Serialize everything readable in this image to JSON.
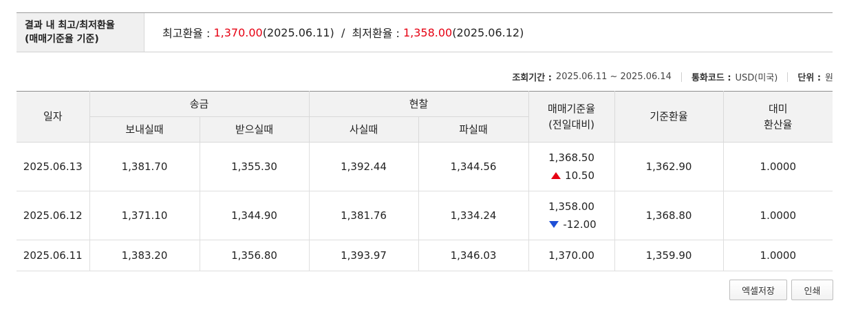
{
  "summary": {
    "label_line1": "결과 내 최고/최저환율",
    "label_line2": "(매매기준율 기준)",
    "high_label": "최고환율 : ",
    "high_value": "1,370.00",
    "high_date": "(2025.06.11)",
    "divider": "  /  ",
    "low_label": "최저환율 : ",
    "low_value": "1,358.00",
    "low_date": "(2025.06.12)",
    "highlight_color": "#e60012"
  },
  "meta": {
    "period_label": "조회기간 :",
    "period_value": "2025.06.11 ~ 2025.06.14",
    "currency_label": "통화코드 :",
    "currency_value": "USD(미국)",
    "unit_label": "단위 :",
    "unit_value": "원"
  },
  "table": {
    "headers": {
      "date": "일자",
      "remit": "송금",
      "send": "보내실때",
      "receive": "받으실때",
      "cash": "현찰",
      "buy": "사실때",
      "sell": "파실때",
      "base_line1": "매매기준율",
      "base_line2": "(전일대비)",
      "standard": "기준환율",
      "usd_line1": "대미",
      "usd_line2": "환산율"
    },
    "rows": [
      {
        "date": "2025.06.13",
        "send": "1,381.70",
        "receive": "1,355.30",
        "buy": "1,392.44",
        "sell": "1,344.56",
        "base": "1,368.50",
        "change": "10.50",
        "change_dir": "up",
        "standard": "1,362.90",
        "usd": "1.0000"
      },
      {
        "date": "2025.06.12",
        "send": "1,371.10",
        "receive": "1,344.90",
        "buy": "1,381.76",
        "sell": "1,334.24",
        "base": "1,358.00",
        "change": "-12.00",
        "change_dir": "down",
        "standard": "1,368.80",
        "usd": "1.0000"
      },
      {
        "date": "2025.06.11",
        "send": "1,383.20",
        "receive": "1,356.80",
        "buy": "1,393.97",
        "sell": "1,346.03",
        "base": "1,370.00",
        "change": "",
        "change_dir": "none",
        "standard": "1,359.90",
        "usd": "1.0000"
      }
    ],
    "up_color": "#e60012",
    "down_color": "#1f4fd6",
    "up_icon": "triangle-up-icon",
    "down_icon": "triangle-down-icon"
  },
  "buttons": {
    "excel": "엑셀저장",
    "print": "인쇄"
  }
}
